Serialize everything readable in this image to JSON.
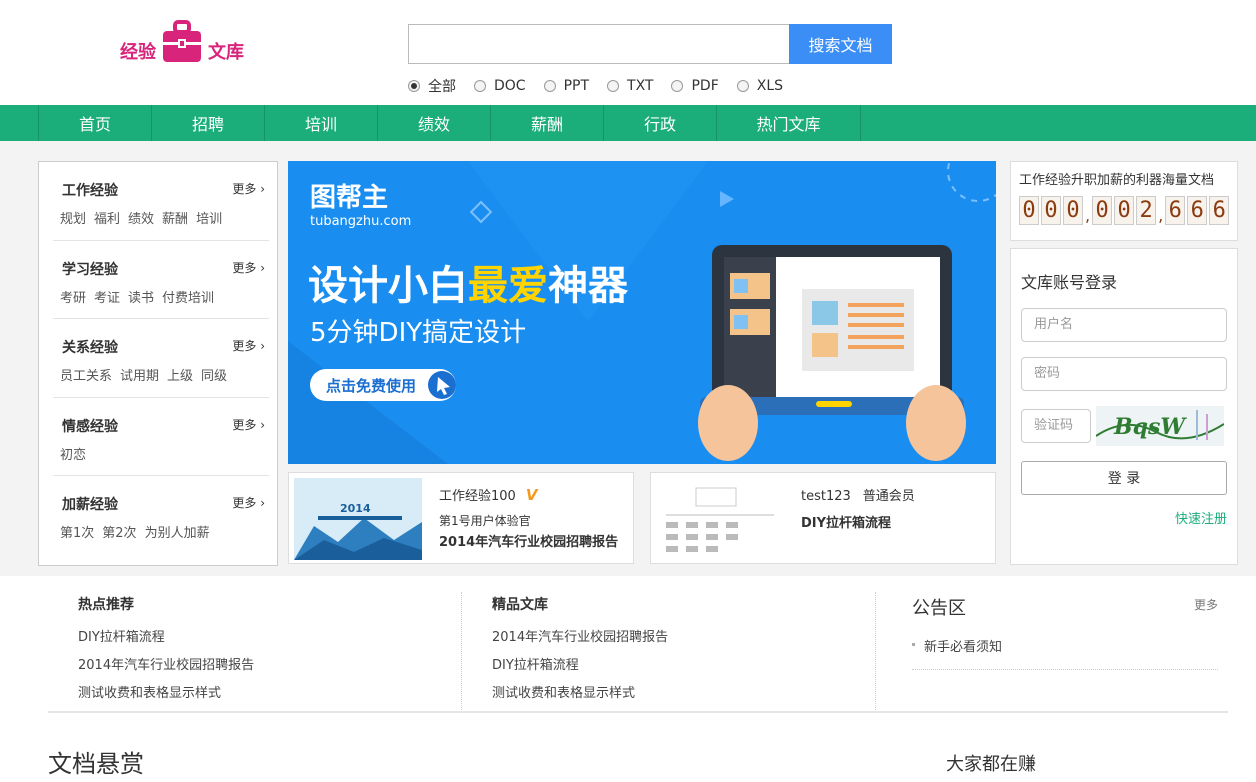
{
  "logo": {
    "left": "经验",
    "right": "文库",
    "icon": "briefcase-icon"
  },
  "search": {
    "value": "",
    "button": "搜索文档"
  },
  "filters": [
    {
      "label": "全部",
      "selected": true
    },
    {
      "label": "DOC",
      "selected": false
    },
    {
      "label": "PPT",
      "selected": false
    },
    {
      "label": "TXT",
      "selected": false
    },
    {
      "label": "PDF",
      "selected": false
    },
    {
      "label": "XLS",
      "selected": false
    }
  ],
  "nav": [
    "首页",
    "招聘",
    "培训",
    "绩效",
    "薪酬",
    "行政",
    "热门文库"
  ],
  "sidebar": {
    "more": "更多 ›",
    "cats": [
      {
        "title": "工作经验",
        "links": [
          "规划",
          "福利",
          "绩效",
          "薪酬",
          "培训"
        ]
      },
      {
        "title": "学习经验",
        "links": [
          "考研",
          "考证",
          "读书",
          "付费培训"
        ]
      },
      {
        "title": "关系经验",
        "links": [
          "员工关系",
          "试用期",
          "上级",
          "同级"
        ]
      },
      {
        "title": "情感经验",
        "links": [
          "初恋"
        ]
      },
      {
        "title": "加薪经验",
        "links": [
          "第1次",
          "第2次",
          "为别人加薪"
        ]
      }
    ]
  },
  "banner": {
    "brand": "图帮主",
    "domain": "tubangzhu.com",
    "headline_a": "设计小白",
    "headline_b": "最爱",
    "headline_c": "神器",
    "subline": "5分钟DIY搞定设计",
    "cta": "点击免费使用",
    "colors": {
      "bg": "#1a8ef0",
      "accent": "#ffd400"
    }
  },
  "cards": [
    {
      "user": "工作经验100",
      "badge": "V",
      "subtitle": "第1号用户体验官",
      "title": "2014年汽车行业校园招聘报告",
      "thumb_text": "2014"
    },
    {
      "user": "test123",
      "role": "普通会员",
      "title": "DIY拉杆箱流程"
    }
  ],
  "counter": {
    "caption": "工作经验升职加薪的利器海量文档",
    "groups": [
      [
        "0",
        "0",
        "0"
      ],
      [
        "0",
        "0",
        "2"
      ],
      [
        "6",
        "6",
        "6"
      ]
    ]
  },
  "login": {
    "title": "文库账号登录",
    "username_ph": "用户名",
    "password_ph": "密码",
    "captcha_ph": "验证码",
    "captcha_text": "BqsW",
    "submit": "登 录",
    "register": "快速注册"
  },
  "hot": {
    "title": "热点推荐",
    "items": [
      "DIY拉杆箱流程",
      "2014年汽车行业校园招聘报告",
      "测试收费和表格显示样式"
    ]
  },
  "featured": {
    "title": "精品文库",
    "items": [
      "2014年汽车行业校园招聘报告",
      "DIY拉杆箱流程",
      "测试收费和表格显示样式"
    ]
  },
  "notice": {
    "title": "公告区",
    "more": "更多",
    "items": [
      "新手必看须知"
    ]
  },
  "bottom": {
    "left": "文档悬赏",
    "right": "大家都在赚"
  }
}
